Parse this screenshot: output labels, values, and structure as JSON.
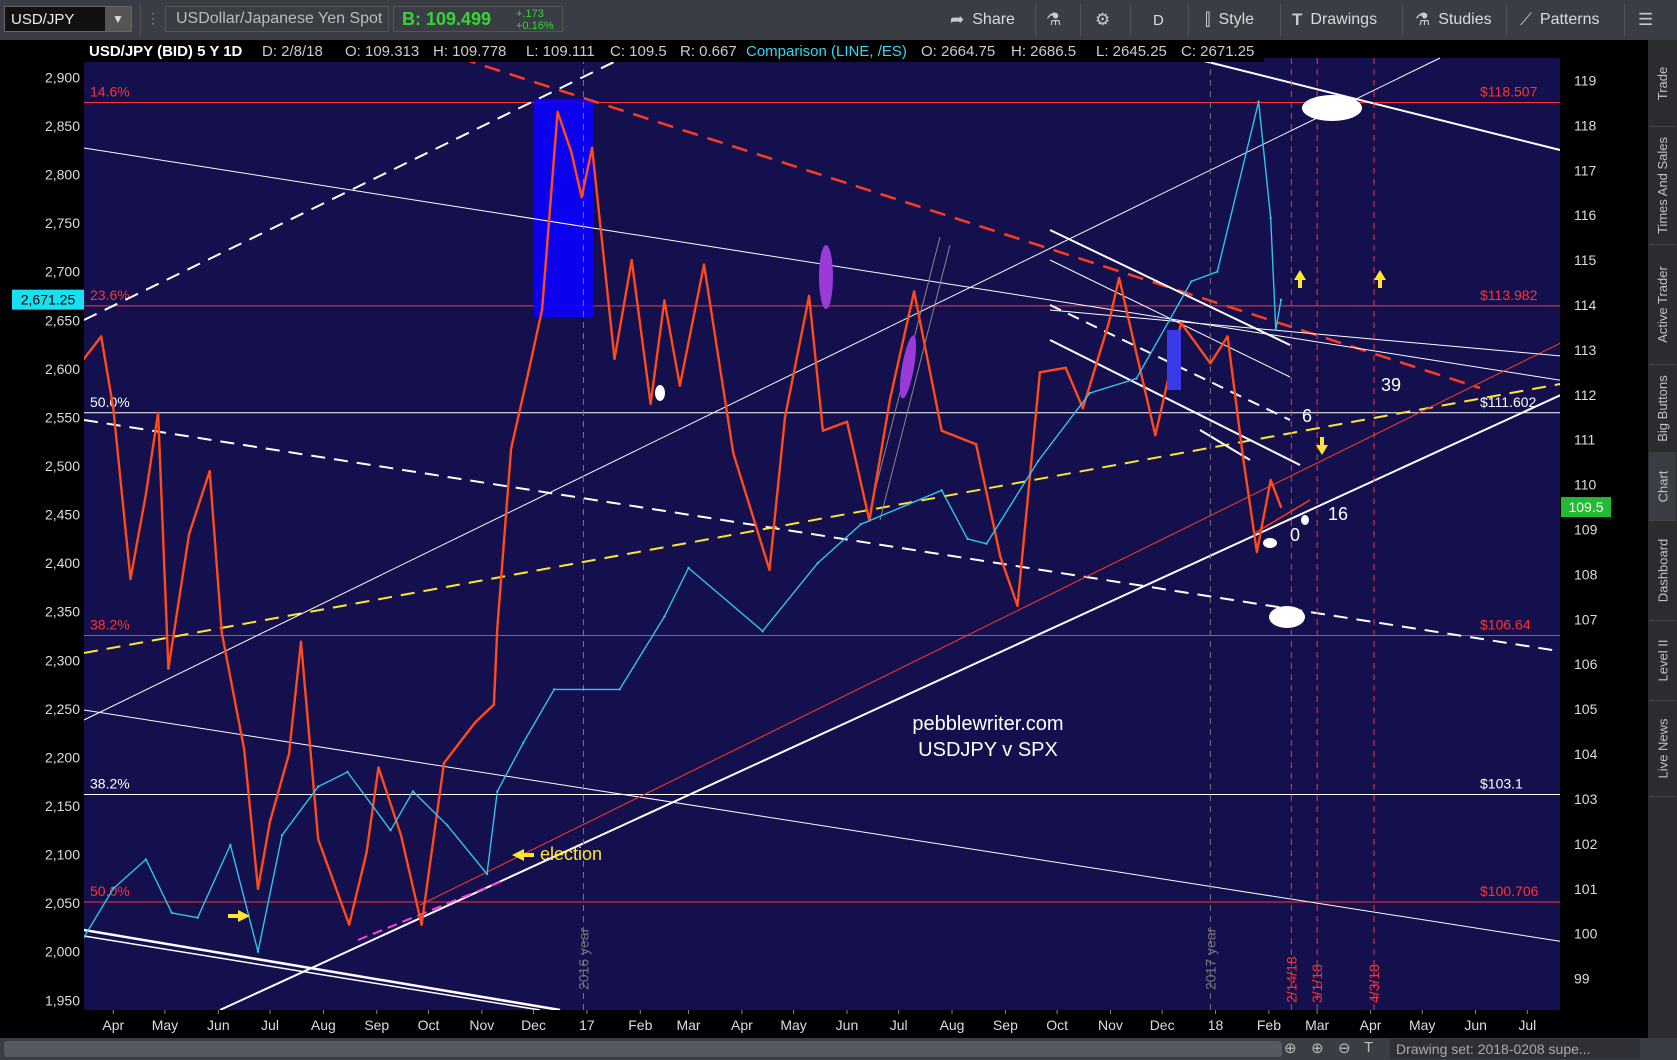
{
  "toolbar": {
    "symbol": "USD/JPY",
    "instrument": "USDollar/Japanese Yen Spot",
    "bid": "B: 109.499",
    "change_abs": "+.173",
    "change_pct": "+0.16%",
    "share": "Share",
    "aggregation": "D",
    "style": "Style",
    "drawings": "Drawings",
    "studies": "Studies",
    "patterns": "Patterns"
  },
  "header": {
    "title": "USD/JPY (BID) 5 Y 1D",
    "date": "D: 2/8/18",
    "open": "O: 109.313",
    "high": "H: 109.778",
    "low": "L: 109.111",
    "close": "C: 109.5",
    "range": "R: 0.667",
    "comparison": "Comparison (LINE, /ES)",
    "c_open": "O: 2664.75",
    "c_high": "H: 2686.5",
    "c_low": "L: 2645.25",
    "c_close": "C: 2671.25"
  },
  "right_tabs": [
    "Trade",
    "Times And Sales",
    "Active Trader",
    "Big Buttons",
    "Chart",
    "Dashboard",
    "Level II",
    "Live News"
  ],
  "bottom": {
    "drawing_set": "Drawing set: 2018-0208 supe..."
  },
  "chart_data": {
    "type": "line",
    "title": "USD/JPY (BID) 5 Y 1D",
    "watermark": [
      "pebblewriter.com",
      "USDJPY v SPX"
    ],
    "x_tick_labels": [
      "Apr",
      "May",
      "Jun",
      "Jul",
      "Aug",
      "Sep",
      "Oct",
      "Nov",
      "Dec",
      "17",
      "Feb",
      "Mar",
      "Apr",
      "May",
      "Jun",
      "Jul",
      "Aug",
      "Sep",
      "Oct",
      "Nov",
      "Dec",
      "18",
      "Feb",
      "Mar",
      "Apr",
      "May",
      "Jun",
      "Jul"
    ],
    "x_range": [
      "2016-03-15",
      "2018-07-20"
    ],
    "left_axis": {
      "label": "/ES",
      "ylim": [
        1940,
        2920
      ],
      "ticks": [
        1950,
        2000,
        2050,
        2100,
        2150,
        2200,
        2250,
        2300,
        2350,
        2400,
        2450,
        2500,
        2550,
        2600,
        2650,
        2700,
        2750,
        2800,
        2850,
        2900
      ],
      "current": "2,671.25",
      "current_color": "#17e0f0"
    },
    "right_axis": {
      "label": "USD/JPY",
      "ylim": [
        98.3,
        119.5
      ],
      "ticks": [
        99,
        100,
        101,
        102,
        103,
        104,
        105,
        106,
        107,
        108,
        109,
        110,
        111,
        112,
        113,
        114,
        115,
        116,
        117,
        118,
        119
      ],
      "current": "109.5",
      "current_color": "#22bb33"
    },
    "series": [
      {
        "name": "USD/JPY",
        "axis": "right",
        "color": "#ff4a1a",
        "points": [
          [
            "2016-03-15",
            112.8
          ],
          [
            "2016-03-25",
            113.3
          ],
          [
            "2016-04-01",
            111.7
          ],
          [
            "2016-04-11",
            107.9
          ],
          [
            "2016-04-20",
            109.8
          ],
          [
            "2016-04-27",
            111.6
          ],
          [
            "2016-05-03",
            105.9
          ],
          [
            "2016-05-15",
            108.9
          ],
          [
            "2016-05-27",
            110.3
          ],
          [
            "2016-06-03",
            106.7
          ],
          [
            "2016-06-16",
            104.1
          ],
          [
            "2016-06-24",
            101.0
          ],
          [
            "2016-07-01",
            102.5
          ],
          [
            "2016-07-12",
            104.0
          ],
          [
            "2016-07-19",
            106.5
          ],
          [
            "2016-07-29",
            102.1
          ],
          [
            "2016-08-16",
            100.2
          ],
          [
            "2016-08-26",
            101.8
          ],
          [
            "2016-09-02",
            103.7
          ],
          [
            "2016-09-15",
            102.2
          ],
          [
            "2016-09-27",
            100.2
          ],
          [
            "2016-10-10",
            103.8
          ],
          [
            "2016-10-28",
            104.7
          ],
          [
            "2016-11-08",
            105.1
          ],
          [
            "2016-11-10",
            106.8
          ],
          [
            "2016-11-18",
            110.8
          ],
          [
            "2016-11-28",
            112.5
          ],
          [
            "2016-12-06",
            113.9
          ],
          [
            "2016-12-15",
            118.3
          ],
          [
            "2016-12-23",
            117.4
          ],
          [
            "2016-12-29",
            116.4
          ],
          [
            "2017-01-04",
            117.5
          ],
          [
            "2017-01-17",
            112.8
          ],
          [
            "2017-01-27",
            115.0
          ],
          [
            "2017-02-07",
            111.8
          ],
          [
            "2017-02-15",
            114.1
          ],
          [
            "2017-02-24",
            112.2
          ],
          [
            "2017-03-10",
            114.9
          ],
          [
            "2017-03-27",
            110.7
          ],
          [
            "2017-04-17",
            108.1
          ],
          [
            "2017-04-26",
            111.5
          ],
          [
            "2017-05-10",
            114.2
          ],
          [
            "2017-05-18",
            111.2
          ],
          [
            "2017-06-01",
            111.4
          ],
          [
            "2017-06-14",
            109.2
          ],
          [
            "2017-06-26",
            111.9
          ],
          [
            "2017-07-10",
            114.3
          ],
          [
            "2017-07-26",
            111.2
          ],
          [
            "2017-08-15",
            110.9
          ],
          [
            "2017-08-29",
            108.4
          ],
          [
            "2017-09-08",
            107.3
          ],
          [
            "2017-09-21",
            112.5
          ],
          [
            "2017-10-06",
            112.6
          ],
          [
            "2017-10-16",
            111.7
          ],
          [
            "2017-10-31",
            113.6
          ],
          [
            "2017-11-06",
            114.6
          ],
          [
            "2017-11-27",
            111.1
          ],
          [
            "2017-12-12",
            113.6
          ],
          [
            "2017-12-29",
            112.7
          ],
          [
            "2018-01-08",
            113.3
          ],
          [
            "2018-01-17",
            110.6
          ],
          [
            "2018-01-25",
            108.5
          ],
          [
            "2018-02-02",
            110.1
          ],
          [
            "2018-02-08",
            109.5
          ]
        ]
      },
      {
        "name": "/ES",
        "axis": "left",
        "color": "#33c2e8",
        "points": [
          [
            "2016-03-15",
            2015
          ],
          [
            "2016-04-01",
            2065
          ],
          [
            "2016-04-20",
            2095
          ],
          [
            "2016-05-05",
            2040
          ],
          [
            "2016-05-20",
            2035
          ],
          [
            "2016-06-08",
            2110
          ],
          [
            "2016-06-24",
            2000
          ],
          [
            "2016-07-08",
            2120
          ],
          [
            "2016-07-29",
            2170
          ],
          [
            "2016-08-15",
            2185
          ],
          [
            "2016-09-09",
            2125
          ],
          [
            "2016-09-22",
            2165
          ],
          [
            "2016-10-12",
            2130
          ],
          [
            "2016-11-04",
            2080
          ],
          [
            "2016-11-10",
            2165
          ],
          [
            "2016-11-25",
            2215
          ],
          [
            "2016-12-13",
            2270
          ],
          [
            "2017-01-20",
            2270
          ],
          [
            "2017-02-15",
            2345
          ],
          [
            "2017-03-01",
            2395
          ],
          [
            "2017-04-13",
            2330
          ],
          [
            "2017-05-15",
            2400
          ],
          [
            "2017-06-09",
            2440
          ],
          [
            "2017-07-26",
            2475
          ],
          [
            "2017-08-10",
            2425
          ],
          [
            "2017-08-21",
            2420
          ],
          [
            "2017-09-20",
            2505
          ],
          [
            "2017-10-20",
            2575
          ],
          [
            "2017-11-16",
            2590
          ],
          [
            "2017-12-18",
            2690
          ],
          [
            "2018-01-02",
            2700
          ],
          [
            "2018-01-26",
            2875
          ],
          [
            "2018-02-02",
            2755
          ],
          [
            "2018-02-05",
            2640
          ],
          [
            "2018-02-08",
            2671
          ]
        ]
      }
    ],
    "horizontal_levels": [
      {
        "label": "14.6%",
        "price": "$118.507",
        "value": 118.51,
        "color": "#ff3333"
      },
      {
        "label": "23.6%",
        "price": "$113.982",
        "value": 113.98,
        "color": "#ff3333"
      },
      {
        "label": "50.0%",
        "price": "$111.602",
        "value": 111.6,
        "color": "#ffffff"
      },
      {
        "label": "38.2%",
        "price": "$106.64",
        "value": 106.64,
        "color": "#ff3333"
      },
      {
        "label": "38.2%",
        "price": "$103.1",
        "value": 103.1,
        "color": "#ffffff"
      },
      {
        "label": "50.0%",
        "price": "$100.706",
        "value": 100.706,
        "color": "#ff3333"
      }
    ],
    "vertical_markers": [
      {
        "label": "2016 year",
        "date": "2016-12-30",
        "color": "#777777"
      },
      {
        "label": "2017 year",
        "date": "2017-12-29",
        "color": "#777777"
      },
      {
        "label": "2/14/18",
        "date": "2018-02-14",
        "color": "#ff3333"
      },
      {
        "label": "3/1/18",
        "date": "2018-03-01",
        "color": "#ff3333"
      },
      {
        "label": "4/3/18",
        "date": "2018-04-03",
        "color": "#ff3333"
      }
    ],
    "annotations": [
      "election",
      "6",
      "16",
      "39",
      "0"
    ],
    "grid": false,
    "legend": "none",
    "colors": {
      "background": "#13104d",
      "toolbar": "#3a3d43"
    }
  }
}
